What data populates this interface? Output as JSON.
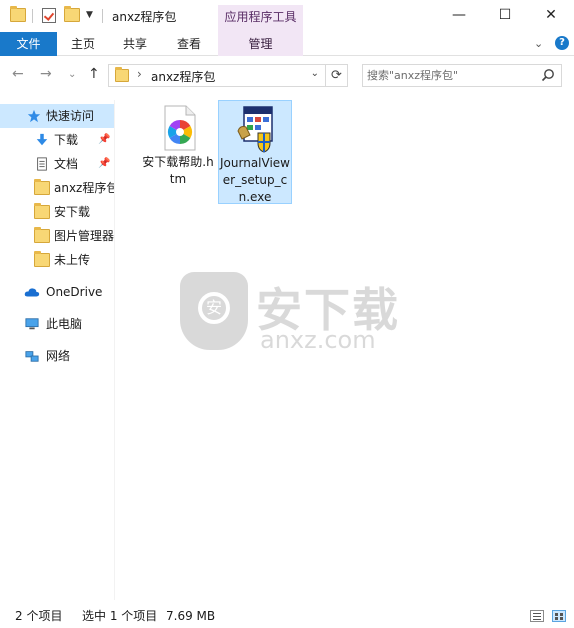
{
  "window": {
    "title": "anxz程序包",
    "context_tab_group": "应用程序工具",
    "minimize": "—",
    "maximize": "☐",
    "close": "✕"
  },
  "ribbon": {
    "tabs": [
      "文件",
      "主页",
      "共享",
      "查看",
      "管理"
    ]
  },
  "address": {
    "crumb": "anxz程序包",
    "search_placeholder": "搜索\"anxz程序包\""
  },
  "sidebar": {
    "quick_access": "快速访问",
    "items": [
      {
        "label": "下载",
        "pinned": true
      },
      {
        "label": "文档",
        "pinned": true
      },
      {
        "label": "anxz程序包",
        "pinned": false
      },
      {
        "label": "安下载",
        "pinned": false
      },
      {
        "label": "图片管理器",
        "pinned": false
      },
      {
        "label": "未上传",
        "pinned": false
      }
    ],
    "onedrive": "OneDrive",
    "this_pc": "此电脑",
    "network": "网络"
  },
  "files": [
    {
      "name": "安下载帮助.htm",
      "icon": "htm-file-icon",
      "selected": false
    },
    {
      "name": "JournalViewer_setup_cn.exe",
      "icon": "installer-exe-icon",
      "selected": true
    }
  ],
  "watermark": {
    "cn": "安下载",
    "en": "anxz.com"
  },
  "status": {
    "item_count": "2 个项目",
    "selection": "选中 1 个项目",
    "size": "7.69 MB"
  },
  "colors": {
    "accent": "#1979ca",
    "selection": "#cce8ff",
    "context_tab": "#f2e6f5",
    "folder": "#f8d775"
  }
}
